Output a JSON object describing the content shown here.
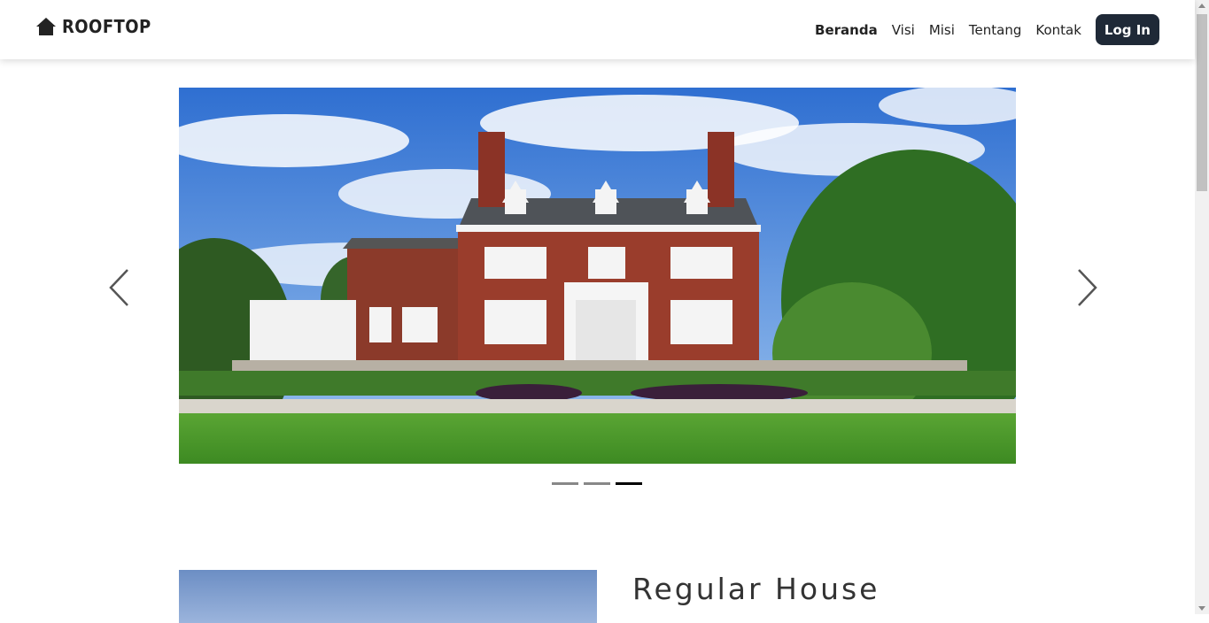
{
  "brand": {
    "name": "ROOFTOP",
    "icon": "house-icon"
  },
  "nav": {
    "items": [
      {
        "label": "Beranda",
        "active": true
      },
      {
        "label": "Visi",
        "active": false
      },
      {
        "label": "Misi",
        "active": false
      },
      {
        "label": "Tentang",
        "active": false
      },
      {
        "label": "Kontak",
        "active": false
      }
    ],
    "login_label": "Log In"
  },
  "carousel": {
    "slide_count": 3,
    "active_index": 2,
    "prev_icon": "chevron-left-icon",
    "next_icon": "chevron-right-icon"
  },
  "section": {
    "title": "Regular House"
  },
  "colors": {
    "login_bg": "#1f2937",
    "text": "#222222",
    "indicator_active": "#000000",
    "indicator": "#888888"
  }
}
